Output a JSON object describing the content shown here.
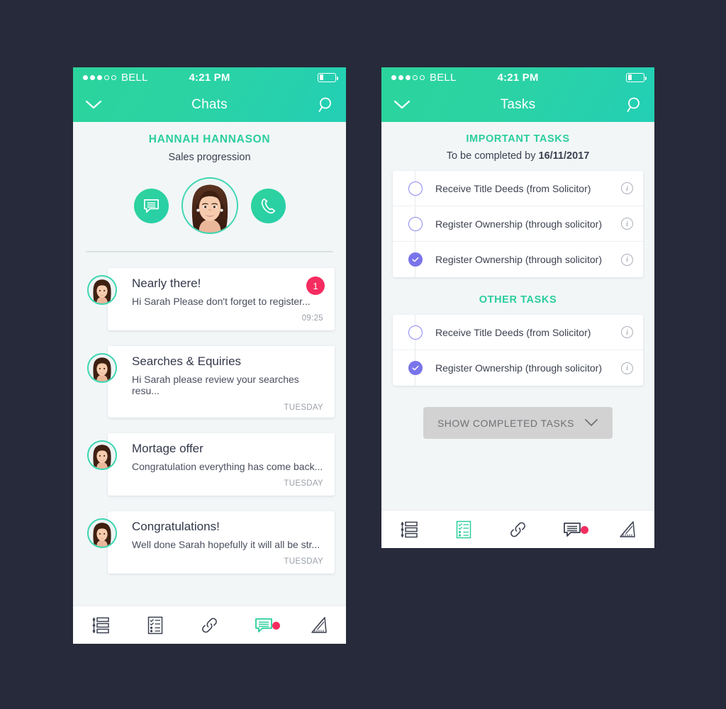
{
  "canvas": {
    "background": "#272A3A"
  },
  "theme": {
    "teal": "#2BCE9B",
    "teal_dark": "#23CFB5",
    "purple": "#7A74EA",
    "pink": "#F42C5F",
    "screen_bg": "#F2F6F7"
  },
  "phone_chats": {
    "status": {
      "carrier": "BELL",
      "time": "4:21 PM",
      "signal_filled": 3,
      "signal_empty": 2,
      "battery_percent": 25
    },
    "nav": {
      "title": "Chats",
      "left_icon": "chevron-down-icon",
      "right_icon": "search-icon"
    },
    "profile": {
      "name": "HANNAH HANNASON",
      "subtitle": "Sales progression",
      "message_icon": "chat-bubble-icon",
      "call_icon": "phone-icon",
      "avatar_icon": "avatar-photo"
    },
    "chats": [
      {
        "title": "Nearly there!",
        "snippet": "Hi Sarah Please don't forget to register...",
        "time": "09:25",
        "badge": "1"
      },
      {
        "title": "Searches & Equiries",
        "snippet": "Hi Sarah please review your searches resu...",
        "time": "TUESDAY",
        "badge": ""
      },
      {
        "title": "Mortage offer",
        "snippet": "Congratulation everything has come back...",
        "time": "TUESDAY",
        "badge": ""
      },
      {
        "title": "Congratulations!",
        "snippet": "Well done Sarah hopefully it will all be str...",
        "time": "TUESDAY",
        "badge": ""
      }
    ],
    "tabs": [
      {
        "icon": "timeline-icon",
        "active": false,
        "badge": false
      },
      {
        "icon": "checklist-icon",
        "active": false,
        "badge": false
      },
      {
        "icon": "link-icon",
        "active": false,
        "badge": false
      },
      {
        "icon": "chat-icon",
        "active": true,
        "badge": true
      },
      {
        "icon": "ruler-icon",
        "active": false,
        "badge": false
      }
    ]
  },
  "phone_tasks": {
    "status": {
      "carrier": "BELL",
      "time": "4:21 PM",
      "signal_filled": 3,
      "signal_empty": 2,
      "battery_percent": 25
    },
    "nav": {
      "title": "Tasks",
      "left_icon": "chevron-down-icon",
      "right_icon": "search-icon"
    },
    "important": {
      "heading": "IMPORTANT TASKS",
      "due_prefix": "To be completed by ",
      "due_date": "16/11/2017",
      "items": [
        {
          "label": "Receive Title Deeds (from Solicitor)",
          "done": false
        },
        {
          "label": "Register Ownership (through solicitor)",
          "done": false
        },
        {
          "label": "Register Ownership (through solicitor)",
          "done": true
        }
      ]
    },
    "other": {
      "heading": "OTHER TASKS",
      "items": [
        {
          "label": "Receive Title Deeds (from Solicitor)",
          "done": false
        },
        {
          "label": "Register Ownership (through solicitor)",
          "done": true
        }
      ]
    },
    "show_completed": {
      "label": "SHOW COMPLETED TASKS",
      "icon": "chevron-down-icon"
    },
    "tabs": [
      {
        "icon": "timeline-icon",
        "active": false,
        "badge": false
      },
      {
        "icon": "checklist-icon",
        "active": true,
        "badge": false
      },
      {
        "icon": "link-icon",
        "active": false,
        "badge": false
      },
      {
        "icon": "chat-icon",
        "active": false,
        "badge": true
      },
      {
        "icon": "ruler-icon",
        "active": false,
        "badge": false
      }
    ]
  }
}
